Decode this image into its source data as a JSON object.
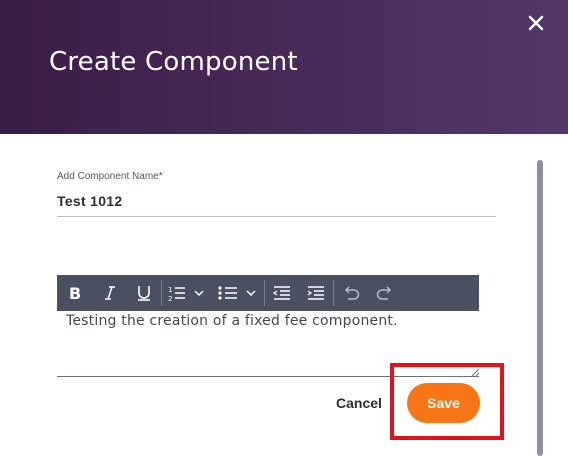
{
  "dialog": {
    "title": "Create Component"
  },
  "form": {
    "name_label": "Add Component Name*",
    "name_value": "Test 1012",
    "description_text": "Testing the creation of a fixed fee component."
  },
  "toolbar": {
    "buttons": [
      "bold-icon",
      "italic-icon",
      "underline-icon",
      "ordered-list-icon",
      "bullet-list-icon",
      "outdent-icon",
      "indent-icon",
      "undo-icon",
      "redo-icon"
    ]
  },
  "actions": {
    "cancel_label": "Cancel",
    "save_label": "Save"
  },
  "colors": {
    "header_start": "#3a1d46",
    "header_end": "#55366b",
    "accent": "#f77515",
    "toolbar_bg": "#4b5060",
    "highlight": "#e0131b"
  }
}
